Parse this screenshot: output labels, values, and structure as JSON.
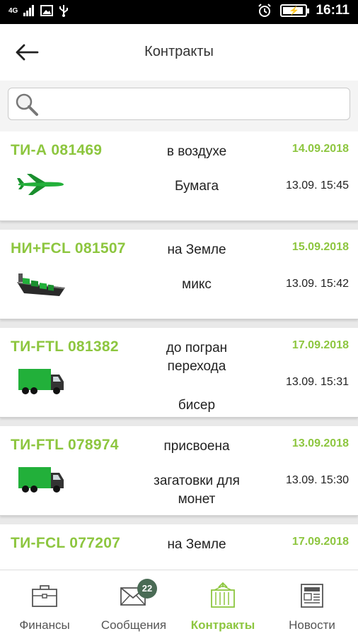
{
  "status_bar": {
    "network": "4G",
    "time": "16:11"
  },
  "header": {
    "title": "Контракты"
  },
  "search": {
    "placeholder": ""
  },
  "contracts": [
    {
      "id": "ТИ-А 081469",
      "status": "в воздухе",
      "date": "14.09.2018",
      "cargo": "Бумага",
      "time": "13.09. 15:45",
      "transport": "airplane-icon"
    },
    {
      "id": "НИ+FCL 081507",
      "status": "на Земле",
      "date": "15.09.2018",
      "cargo": "микс",
      "time": "13.09. 15:42",
      "transport": "ship-icon"
    },
    {
      "id": "ТИ-FTL 081382",
      "status": "до погран перехода",
      "date": "17.09.2018",
      "cargo": "бисер",
      "time": "13.09. 15:31",
      "transport": "truck-icon"
    },
    {
      "id": "ТИ-FTL 078974",
      "status": "присвоена",
      "date": "13.09.2018",
      "cargo": "загатовки для монет",
      "time": "13.09. 15:30",
      "transport": "truck-icon"
    },
    {
      "id": "ТИ-FCL 077207",
      "status": "на Земле",
      "date": "17.09.2018",
      "cargo": "",
      "time": "",
      "transport": "ship-icon"
    }
  ],
  "bottom_nav": {
    "items": [
      {
        "label": "Финансы",
        "icon": "briefcase-icon",
        "active": false
      },
      {
        "label": "Сообщения",
        "icon": "envelope-icon",
        "active": false,
        "badge": "22"
      },
      {
        "label": "Контракты",
        "icon": "container-icon",
        "active": true
      },
      {
        "label": "Новости",
        "icon": "newspaper-icon",
        "active": false
      }
    ]
  },
  "colors": {
    "accent": "#8dc63f",
    "badge": "#4a6b55",
    "vehicle_green": "#22b03a",
    "status_bar": "#000000"
  }
}
